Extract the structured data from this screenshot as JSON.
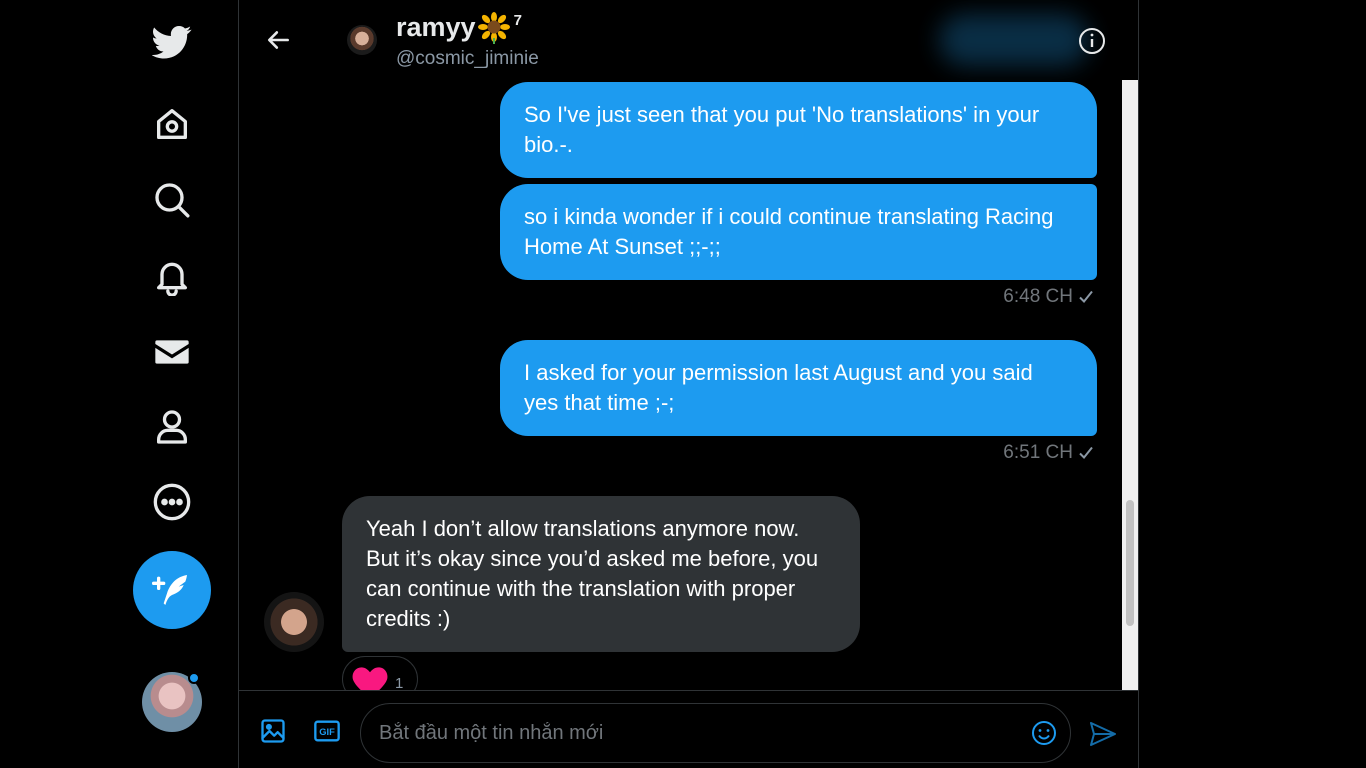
{
  "conversation": {
    "name": "ramyy",
    "name_superscript": "7",
    "handle": "@cosmic_jiminie"
  },
  "messages": [
    {
      "direction": "outgoing",
      "text": "So I've just seen that you put 'No translations' in your bio.-."
    },
    {
      "direction": "outgoing",
      "text": "so i kinda wonder if i could continue translating Racing Home At Sunset ;;-;;",
      "time": "6:48 CH"
    },
    {
      "direction": "outgoing",
      "text": "I asked for your permission last August and you said yes that time ;-;",
      "time": "6:51 CH"
    },
    {
      "direction": "incoming",
      "text": "Yeah I don’t allow translations anymore now. But it’s okay since you’d asked me before, you can continue with the translation with proper credits :)",
      "reaction_count": "1"
    }
  ],
  "composer": {
    "placeholder": "Bắt đầu một tin nhắn mới"
  },
  "colors": {
    "accent": "#1d9bf0",
    "background": "#000000",
    "incoming_bubble": "#2f3336",
    "reaction_heart": "#f91880"
  },
  "icons": {
    "nav": [
      "twitter-bird-icon",
      "home-icon",
      "search-icon",
      "bell-icon",
      "mail-icon",
      "profile-icon",
      "more-icon",
      "compose-tweet-icon"
    ],
    "header": [
      "back-arrow-icon",
      "sunflower-icon",
      "info-icon"
    ],
    "composer": [
      "image-icon",
      "gif-icon",
      "emoji-icon",
      "send-icon"
    ]
  }
}
